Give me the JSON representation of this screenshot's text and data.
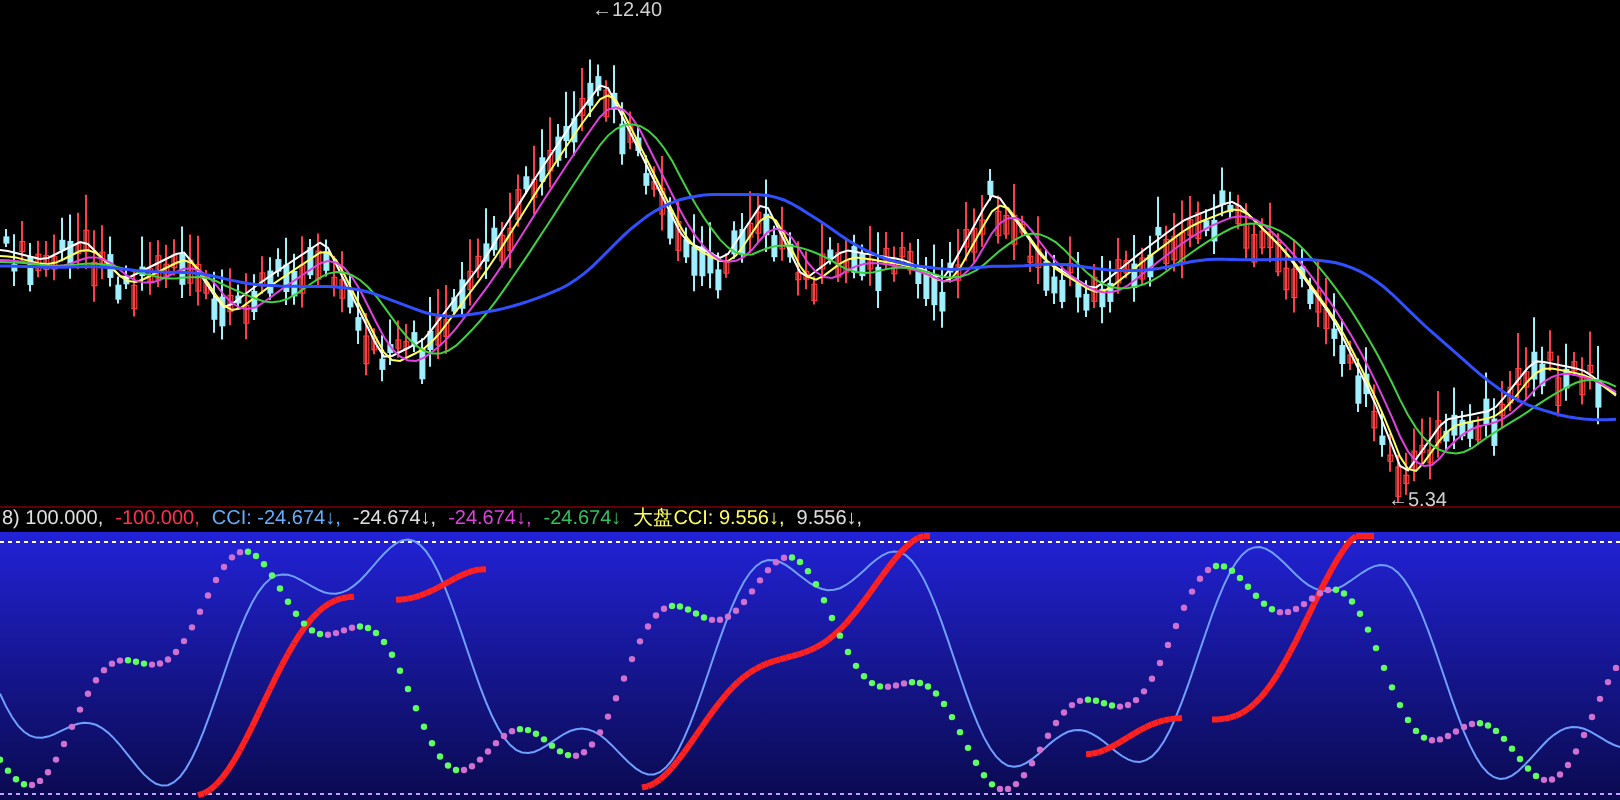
{
  "price_chart": {
    "high_label": "←12.40",
    "low_label": "←5.34"
  },
  "indicator": {
    "legend": [
      {
        "text": "8) 100.000,",
        "kind": "upper"
      },
      {
        "text": "-100.000,",
        "kind": "lower"
      },
      {
        "text": "CCI: -24.674↓,",
        "kind": "cci"
      },
      {
        "text": "-24.674↓,",
        "kind": "plain"
      },
      {
        "text": "-24.674↓,",
        "kind": "rising"
      },
      {
        "text": "-24.674↓",
        "kind": "falling"
      },
      {
        "text": "大盘CCI: 9.556↓,",
        "kind": "market"
      },
      {
        "text": "9.556↓,",
        "kind": "plain"
      }
    ]
  }
}
